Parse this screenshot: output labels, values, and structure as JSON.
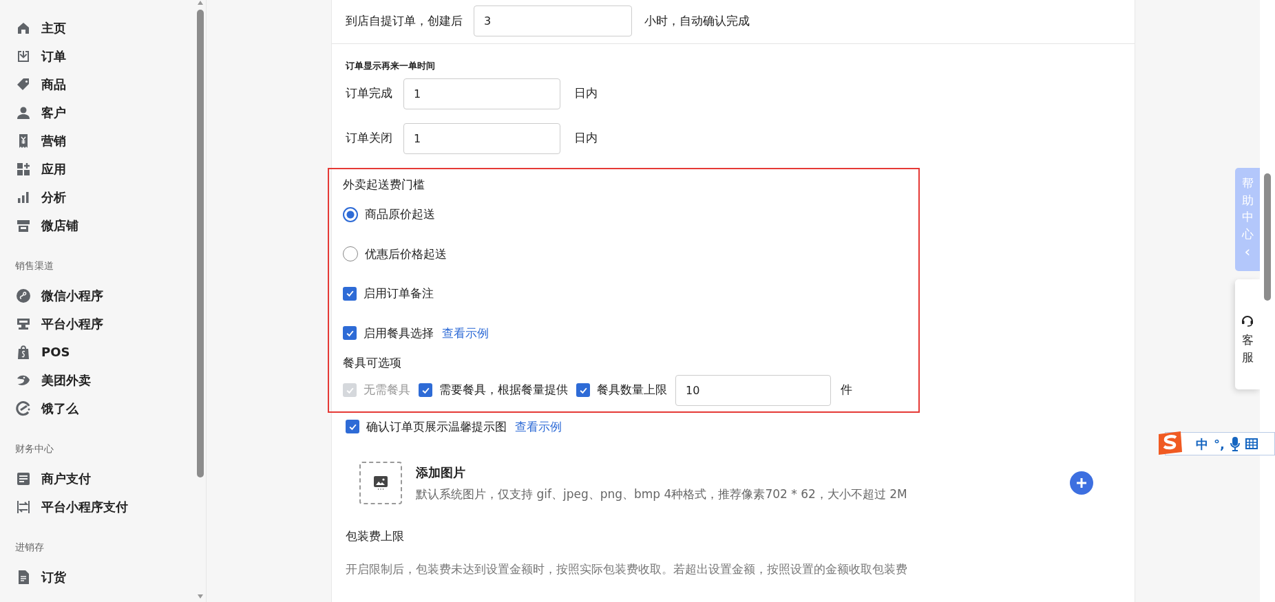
{
  "sidebar": {
    "groups": [
      {
        "items": [
          {
            "label": "主页"
          },
          {
            "label": "订单"
          },
          {
            "label": "商品"
          },
          {
            "label": "客户"
          },
          {
            "label": "营销"
          },
          {
            "label": "应用"
          },
          {
            "label": "分析"
          },
          {
            "label": "微店铺"
          }
        ]
      },
      {
        "heading": "销售渠道",
        "items": [
          {
            "label": "微信小程序"
          },
          {
            "label": "平台小程序"
          },
          {
            "label": "POS"
          },
          {
            "label": "美团外卖"
          },
          {
            "label": "饿了么"
          }
        ]
      },
      {
        "heading": "财务中心",
        "items": [
          {
            "label": "商户支付"
          },
          {
            "label": "平台小程序支付"
          }
        ]
      },
      {
        "heading": "进销存",
        "items": [
          {
            "label": "订货"
          }
        ]
      }
    ]
  },
  "form": {
    "pickup_row": {
      "label": "到店自提订单，创建后",
      "value": "3",
      "suffix": "小时，自动确认完成"
    },
    "reorder": {
      "title": "订单显示再来一单时间",
      "rows": [
        {
          "label": "订单完成",
          "value": "1",
          "suffix": "日内"
        },
        {
          "label": "订单关闭",
          "value": "1",
          "suffix": "日内"
        }
      ]
    },
    "delivery": {
      "highlighted": true,
      "title": "外卖起送费门槛",
      "threshold_options": [
        {
          "label": "商品原价起送",
          "selected": true
        },
        {
          "label": "优惠后价格起送",
          "selected": false
        }
      ],
      "toggles": [
        {
          "label": "启用订单备注",
          "checked": true
        },
        {
          "label": "启用餐具选择",
          "checked": true,
          "link": "查看示例"
        }
      ],
      "utensils": {
        "title": "餐具可选项",
        "options": [
          {
            "label": "无需餐具",
            "checked": true,
            "disabled": true
          },
          {
            "label": "需要餐具，根据餐量提供",
            "checked": true,
            "disabled": false
          },
          {
            "label": "餐具数量上限",
            "checked": true,
            "disabled": false
          }
        ],
        "limit_value": "10",
        "limit_unit": "件"
      }
    },
    "tip_image": {
      "label": "确认订单页展示温馨提示图",
      "checked": true,
      "link": "查看示例",
      "upload_title": "添加图片",
      "upload_hint": "默认系统图片，仅支持 gif、jpeg、png、bmp 4种格式，推荐像素702 * 62，大小不超过 2M"
    },
    "packing": {
      "title": "包装费上限",
      "description": "开启限制后，包装费未达到设置金额时，按照实际包装费收取。若超出设置金额，按照设置的金额收取包装费"
    }
  },
  "help_tab": {
    "text": "帮助中心",
    "arrow": "‹"
  },
  "service": {
    "text": "客服"
  },
  "ime_toolbar": {
    "mode": "中",
    "punctuation": "°,"
  }
}
